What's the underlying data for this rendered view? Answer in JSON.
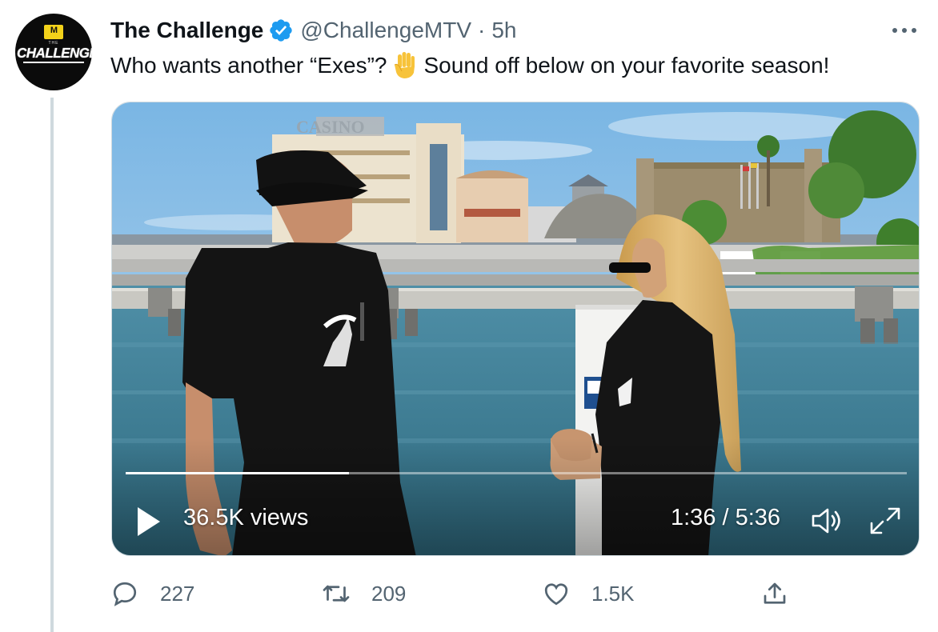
{
  "account": {
    "display_name": "The Challenge",
    "handle": "@ChallengeMTV",
    "separator": "·",
    "time": "5h",
    "avatar": {
      "logo_text": "M",
      "sub_text": "THE",
      "word": "CHALLENGE"
    }
  },
  "tweet": {
    "text_before": "Who wants another “Exes”?",
    "emoji": "raised-hand-emoji",
    "text_after": "Sound off below on your favorite season!"
  },
  "video": {
    "views": "36.5K views",
    "timecode": "1:36 / 5:36",
    "progress": 0.2857,
    "sign_text": "CASINO"
  },
  "actions": {
    "replies": "227",
    "retweets": "209",
    "likes": "1.5K"
  },
  "colors": {
    "verified": "#1d9bf0",
    "secondary_text": "#536471",
    "thread_line": "#cfd9de"
  },
  "icons": [
    "verified-badge-icon",
    "more-icon",
    "play-icon",
    "volume-icon",
    "fullscreen-icon",
    "reply-icon",
    "retweet-icon",
    "like-icon",
    "share-icon"
  ]
}
